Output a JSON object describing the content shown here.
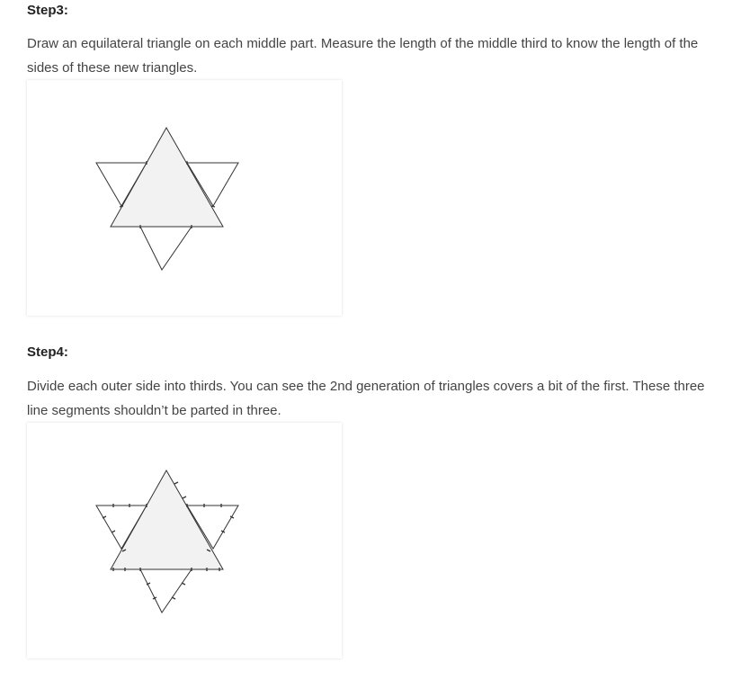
{
  "step3": {
    "heading": "Step3:",
    "text": "Draw an equilateral triangle on each middle part. Measure the length of the middle third to know the length of the sides of these new triangles."
  },
  "step4": {
    "heading": "Step4:",
    "text": "Divide each outer side into thirds. You can see the 2nd generation of triangles covers a bit of the first. These three line segments shouldn’t be parted in three."
  },
  "colors": {
    "text": "#444444",
    "heading": "#222222",
    "triangle_fill": "#f2f2f2",
    "stroke": "#333333"
  }
}
